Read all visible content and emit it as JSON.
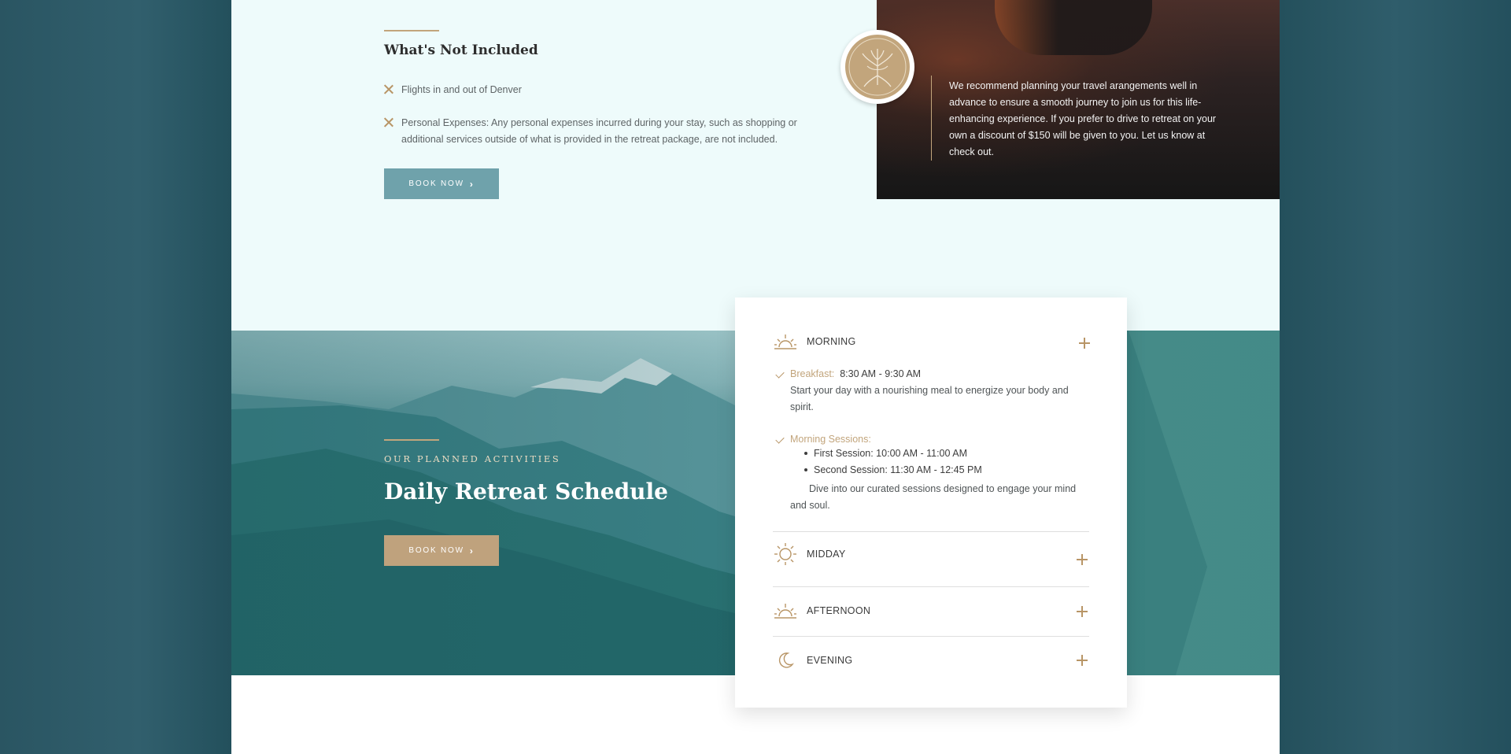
{
  "not_included": {
    "title": "What's Not Included",
    "items": [
      "Flights in and out of Denver",
      "Personal Expenses: Any personal expenses incurred during your stay, such as shopping or additional services outside of what is provided in the retreat package, are not included."
    ],
    "book_label": "BOOK NOW"
  },
  "travel_note": "We recommend planning your travel arangements well in advance to ensure a smooth journey to join us for this life-enhancing experience. If you prefer to drive to retreat on your own a discount of $150 will be given to you. Let us know at check out.",
  "schedule_hero": {
    "eyebrow": "OUR PLANNED ACTIVITIES",
    "title": "Daily Retreat Schedule",
    "book_label": "BOOK NOW"
  },
  "schedule": {
    "morning": {
      "label": "MORNING",
      "breakfast_label": "Breakfast:",
      "breakfast_time": "8:30 AM - 9:30 AM",
      "breakfast_desc": "Start your day with a nourishing meal to energize your body and spirit.",
      "sessions_label": "Morning Sessions:",
      "sessions": [
        "First Session: 10:00 AM - 11:00 AM",
        "Second Session: 11:30 AM - 12:45 PM"
      ],
      "sessions_desc": "Dive into our curated sessions designed to engage your mind and soul."
    },
    "midday": {
      "label": "MIDDAY"
    },
    "afternoon": {
      "label": "AFTERNOON"
    },
    "evening": {
      "label": "EVENING"
    }
  },
  "icons": {
    "morning": "sunrise-icon",
    "midday": "sun-icon",
    "afternoon": "sunset-icon",
    "evening": "moon-icon",
    "expand": "plus-icon",
    "excluded": "x-icon",
    "included": "check-icon"
  },
  "colors": {
    "gold": "#c2a57c",
    "teal_button": "#6fa2ab",
    "gold_button": "#bfa27d",
    "top_section_bg": "#eefbfb"
  }
}
